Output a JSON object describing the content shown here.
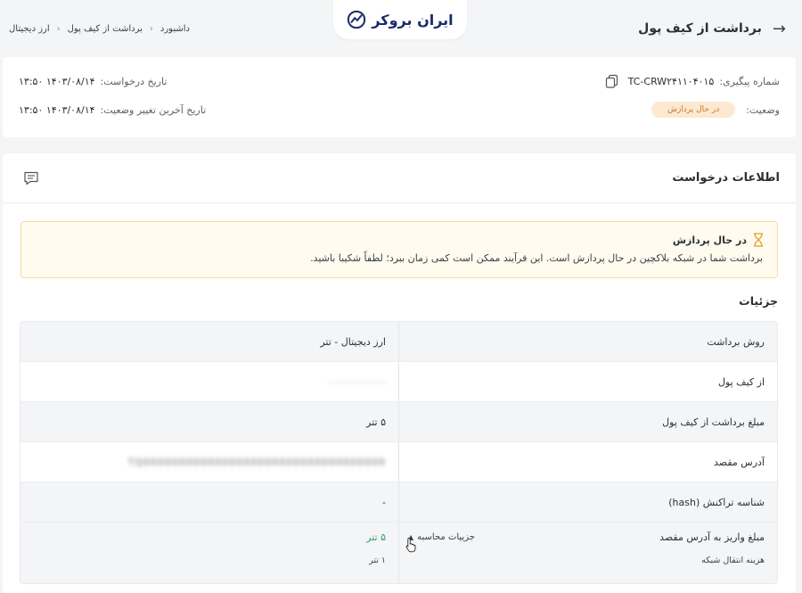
{
  "header": {
    "title": "برداشت از کیف پول",
    "logo_text": "ایران بروکر",
    "breadcrumb": [
      "داشبورد",
      "برداشت از کیف پول",
      "ارز دیجیتال"
    ]
  },
  "summary": {
    "tracking_label": "شماره پیگیری:",
    "tracking_value": "TC-CRW۲۴۱۱۰۴۰۱۵",
    "status_label": "وضعیت:",
    "status_value": "در حال پردازش",
    "request_date_label": "تاریخ درخواست:",
    "request_date_value": "۱۴۰۳/۰۸/۱۴ ۱۳:۵۰",
    "last_change_label": "تاریخ آخرین تغییر وضعیت:",
    "last_change_value": "۱۴۰۳/۰۸/۱۴ ۱۳:۵۰"
  },
  "section": {
    "title": "اطلاعات درخواست"
  },
  "alert": {
    "title": "در حال پردازش",
    "text": "برداشت شما در شبکه بلاکچین در حال پردازش است. این فرآیند ممکن است کمی زمان ببرد؛ لطفاً شکیبا باشید."
  },
  "details": {
    "title": "جزئیات",
    "rows": [
      {
        "label": "روش برداشت",
        "value": "ارز دیجیتال - تتر"
      },
      {
        "label": "از کیف پول",
        "value": "۰۰۰۰۰۰۰۰۰۰۰"
      },
      {
        "label": "مبلغ برداشت از کیف پول",
        "value": "۵ تتر"
      },
      {
        "label": "آدرس مقصد",
        "value": "TQ0000000000000000000000000000000000"
      },
      {
        "label": "شناسه تراکنش (hash)",
        "value": "-"
      }
    ],
    "final": {
      "label": "مبلغ واریز به آدرس مقصد",
      "value": "۵ تتر",
      "calc_link": "جزییات محاسبه",
      "fee_label": "هزینه انتقال شبکه",
      "fee_value": "۱ تتر"
    }
  },
  "colors": {
    "badge_bg": "#fde8d2",
    "badge_text": "#c97a2a",
    "alert_bg": "#fffbee",
    "alert_border": "#f3dba6",
    "amount_green": "#2f9e6b",
    "logo_navy": "#1a2b6d"
  }
}
